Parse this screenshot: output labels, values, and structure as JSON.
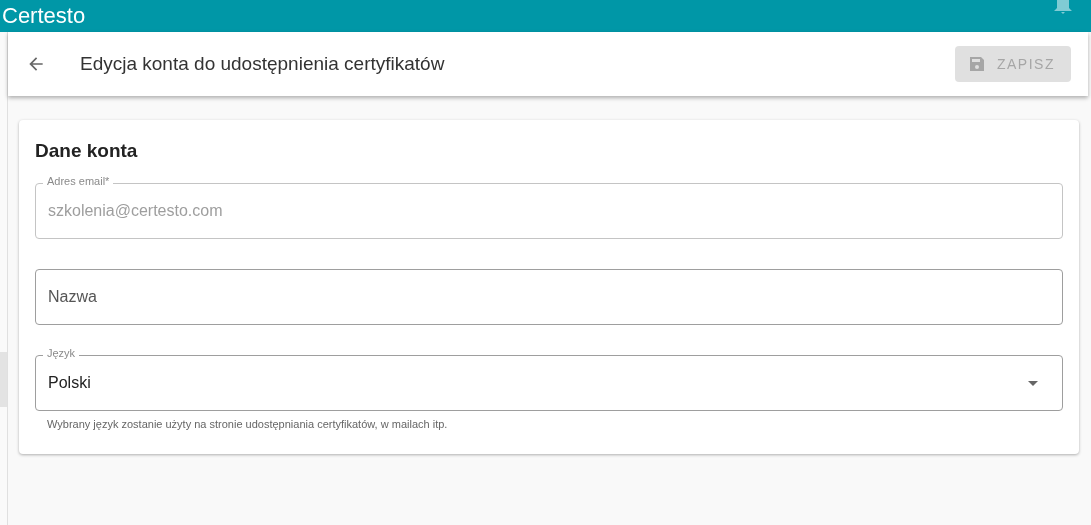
{
  "app_bar": {
    "title": "Certesto"
  },
  "toolbar": {
    "title": "Edycja konta do udostępnienia certyfikatów",
    "save_button": {
      "label": "ZAPISZ",
      "disabled": true
    }
  },
  "card": {
    "title": "Dane konta",
    "fields": [
      {
        "kind": "text",
        "label": "Adres email*",
        "value": "szkolenia@certesto.com",
        "disabled": true
      },
      {
        "kind": "text",
        "placeholder": "Nazwa",
        "disabled": false
      },
      {
        "kind": "select",
        "label": "Język",
        "value": "Polski",
        "hint": "Wybrany język zostanie użyty na stronie udostępniania certyfikatów, w mailach itp."
      }
    ]
  }
}
